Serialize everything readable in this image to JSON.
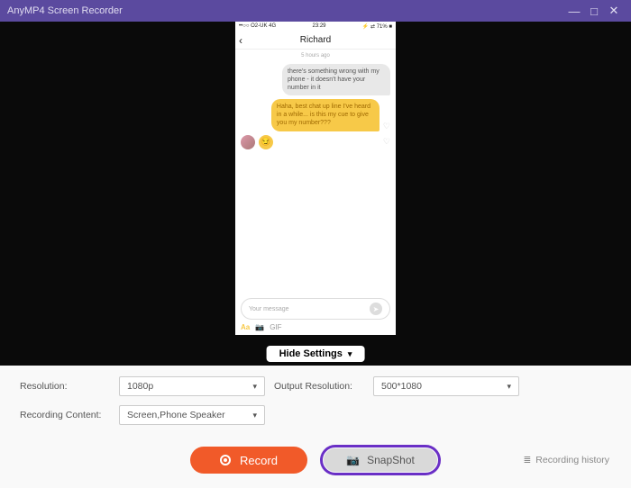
{
  "window": {
    "title": "AnyMP4 Screen Recorder",
    "minimize": "—",
    "maximize": "□",
    "close": "✕"
  },
  "phone": {
    "status_left": "••○○ O2-UK  4G",
    "status_time": "23:29",
    "status_right": "⚡ ⇄ 71% ■",
    "contact": "Richard",
    "time_ago": "5 hours ago",
    "msg1": "there's something wrong with my phone - it doesn't have your number in it",
    "msg2": "Haha, best chat up line I've heard in a while... is this my cue to give you my number???",
    "composer_placeholder": "Your message",
    "aa": "Aa",
    "gif": "GIF"
  },
  "hide_settings": "Hide Settings",
  "settings": {
    "resolution_label": "Resolution:",
    "resolution_value": "1080p",
    "output_label": "Output Resolution:",
    "output_value": "500*1080",
    "content_label": "Recording Content:",
    "content_value": "Screen,Phone Speaker"
  },
  "footer": {
    "record": "Record",
    "snapshot": "SnapShot",
    "history": "Recording history"
  }
}
